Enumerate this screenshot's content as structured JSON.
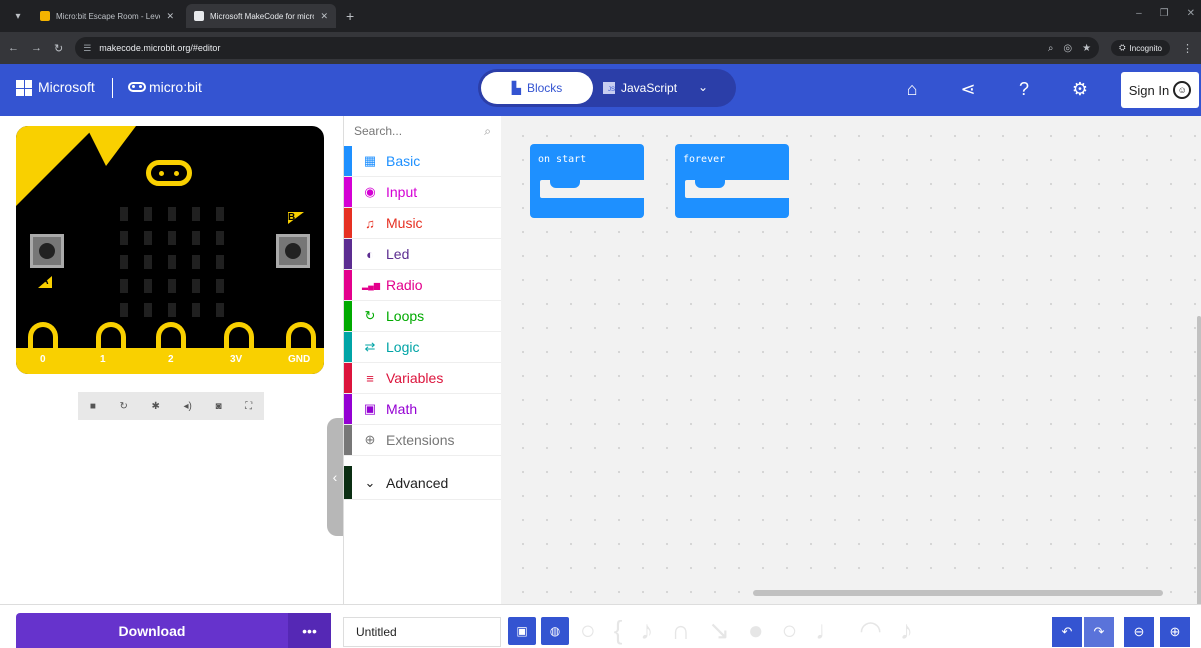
{
  "browser": {
    "tabs": [
      {
        "title": "Micro:bit Escape Room - Level",
        "active": false
      },
      {
        "title": "Microsoft MakeCode for micro",
        "active": true
      }
    ],
    "url": "makecode.microbit.org/#editor",
    "incognito_label": "Incognito"
  },
  "header": {
    "brand": "Microsoft",
    "product": "micro:bit",
    "mode_blocks": "Blocks",
    "mode_javascript": "JavaScript",
    "sign_in": "Sign In"
  },
  "simulator": {
    "pins": [
      "0",
      "1",
      "2",
      "3V",
      "GND"
    ],
    "button_a": "A",
    "button_b": "B"
  },
  "toolbox": {
    "search_placeholder": "Search...",
    "categories": [
      {
        "label": "Basic",
        "color": "#1e90ff",
        "icon": "grid-icon",
        "glyph": "▦"
      },
      {
        "label": "Input",
        "color": "#d400d4",
        "icon": "target-icon",
        "glyph": "◉"
      },
      {
        "label": "Music",
        "color": "#e63022",
        "icon": "headphones-icon",
        "glyph": "♫"
      },
      {
        "label": "Led",
        "color": "#5c2d91",
        "icon": "toggle-icon",
        "glyph": "◐"
      },
      {
        "label": "Radio",
        "color": "#e3008c",
        "icon": "signal-icon",
        "glyph": "▂▄▆"
      },
      {
        "label": "Loops",
        "color": "#00aa00",
        "icon": "loop-icon",
        "glyph": "↻"
      },
      {
        "label": "Logic",
        "color": "#00a4a6",
        "icon": "shuffle-icon",
        "glyph": "⇄"
      },
      {
        "label": "Variables",
        "color": "#dc143c",
        "icon": "list-icon",
        "glyph": "≡"
      },
      {
        "label": "Math",
        "color": "#9400d3",
        "icon": "calculator-icon",
        "glyph": "▣"
      },
      {
        "label": "Extensions",
        "color": "#777777",
        "icon": "plus-circle-icon",
        "glyph": "⊕"
      }
    ],
    "advanced": "Advanced"
  },
  "workspace": {
    "blocks": [
      {
        "label": "on start"
      },
      {
        "label": "forever"
      }
    ]
  },
  "bottom": {
    "download": "Download",
    "more": "•••",
    "project_name": "Untitled"
  }
}
